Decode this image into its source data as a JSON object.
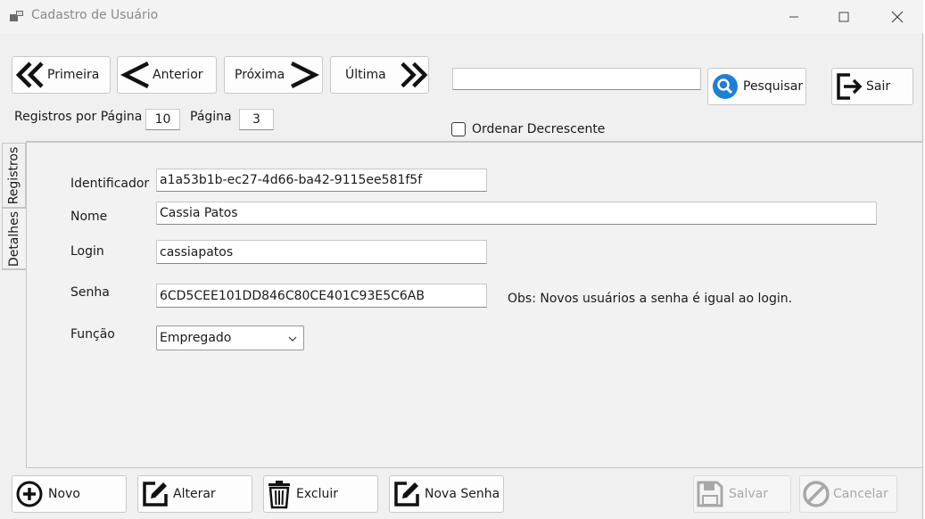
{
  "window": {
    "title": "Cadastro de Usuário"
  },
  "nav": {
    "first": "Primeira",
    "prev": "Anterior",
    "next": "Próxima",
    "last": "Última"
  },
  "search": {
    "value": "",
    "button": "Pesquisar"
  },
  "exit_button": "Sair",
  "paging": {
    "per_page_label": "Registros por Página",
    "per_page_value": "10",
    "page_label": "Página",
    "page_value": "3"
  },
  "order_desc": {
    "label": "Ordenar Decrescente",
    "checked": false
  },
  "tabs": {
    "records": "Registros",
    "details": "Detalhes"
  },
  "form": {
    "id_label": "Identificador",
    "id_value": "a1a53b1b-ec27-4d66-ba42-9115ee581f5f",
    "name_label": "Nome",
    "name_value": "Cassia Patos",
    "login_label": "Login",
    "login_value": "cassiapatos",
    "password_label": "Senha",
    "password_value": "6CD5CEE101DD846C80CE401C93E5C6AB",
    "password_note": "Obs: Novos usuários a senha é igual ao login.",
    "role_label": "Função",
    "role_value": "Empregado"
  },
  "actions": {
    "new": "Novo",
    "edit": "Alterar",
    "delete": "Excluir",
    "new_password": "Nova Senha",
    "save": "Salvar",
    "cancel": "Cancelar"
  },
  "colors": {
    "search_icon": "#1e7fd9",
    "disabled_text": "#a8a8a8"
  }
}
